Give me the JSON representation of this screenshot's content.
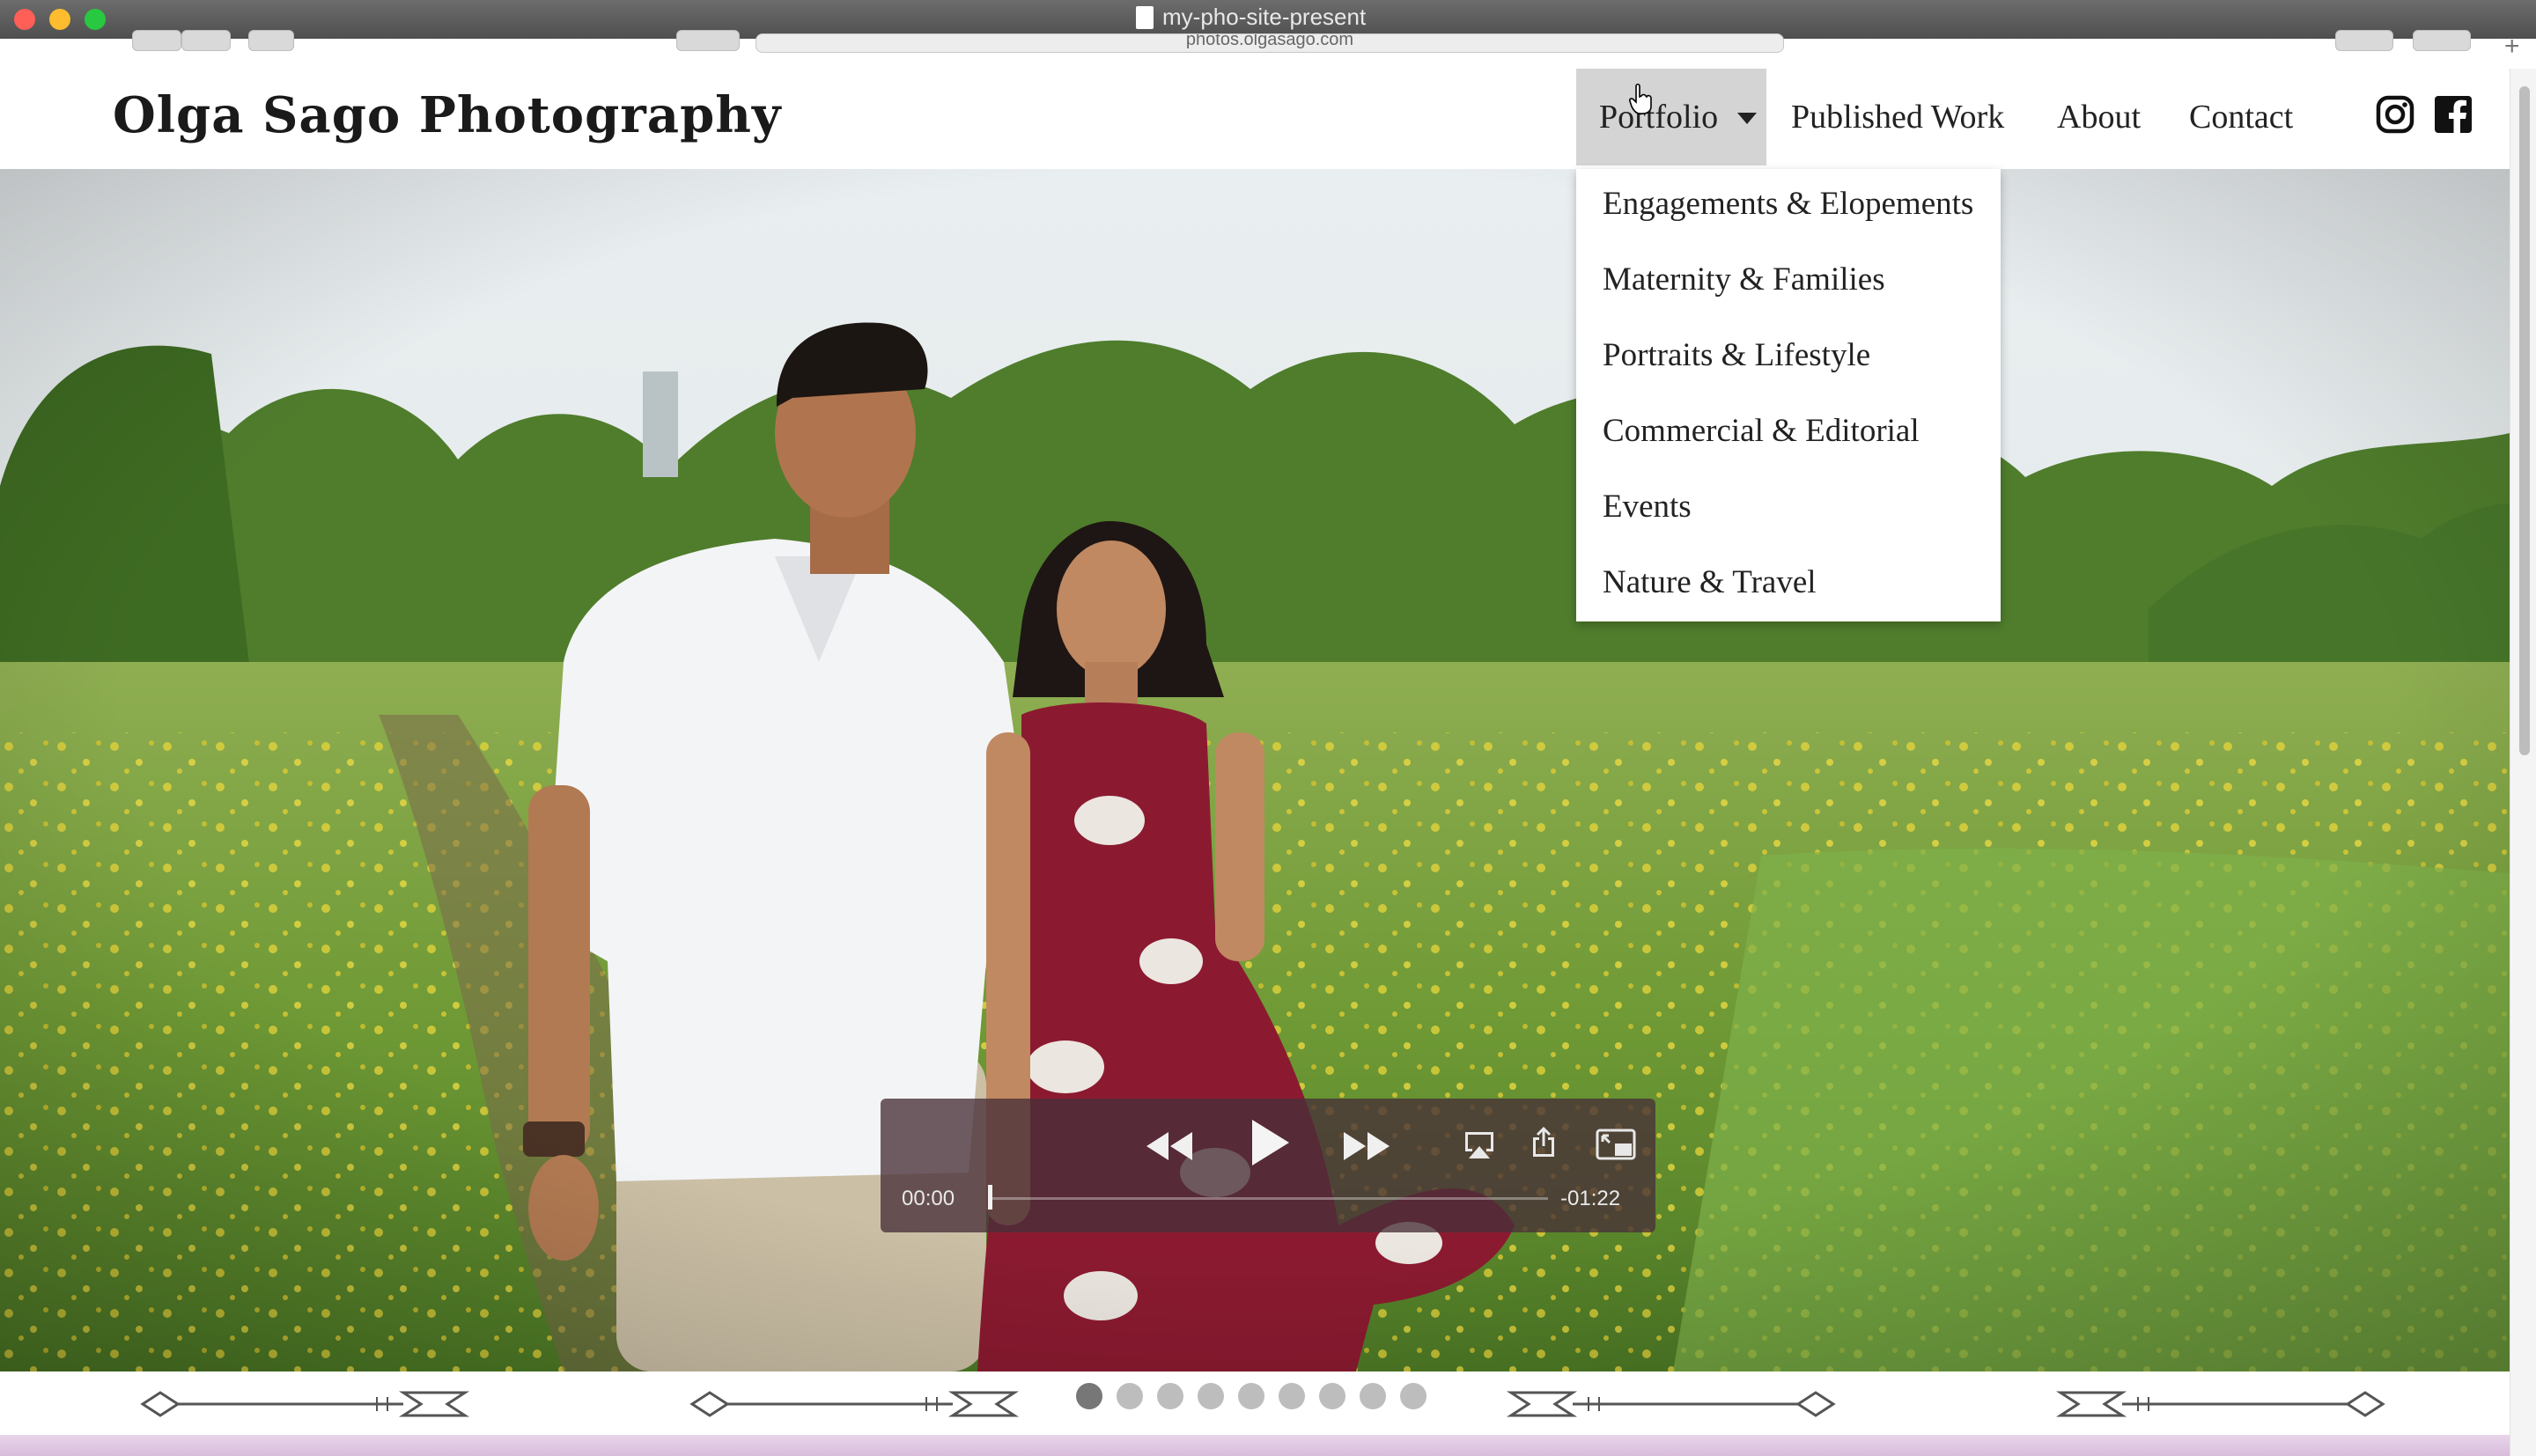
{
  "window": {
    "title": "my-pho-site-present",
    "url": "photos.olgasago.com"
  },
  "header": {
    "logo": "Olga Sago Photography",
    "nav": {
      "portfolio": "Portfolio",
      "published_work": "Published Work",
      "about": "About",
      "contact": "Contact"
    },
    "social": [
      "instagram-icon",
      "facebook-icon"
    ]
  },
  "portfolio_menu": {
    "items": [
      "Engagements & Elopements",
      "Maternity & Families",
      "Portraits & Lifestyle",
      "Commercial & Editorial",
      "Events",
      "Nature & Travel"
    ]
  },
  "video": {
    "current_time": "00:00",
    "remaining_time": "-01:22",
    "progress": 0,
    "buttons": [
      "rewind-icon",
      "play-icon",
      "fast-forward-icon",
      "airplay-icon",
      "share-icon",
      "picture-in-picture-icon"
    ]
  },
  "carousel": {
    "slide_count": 9,
    "active_index": 0
  },
  "colors": {
    "accent_active_nav": "#d4d4d4",
    "footer_strip": "#d9bcdc",
    "dress": "#8b1a30"
  }
}
